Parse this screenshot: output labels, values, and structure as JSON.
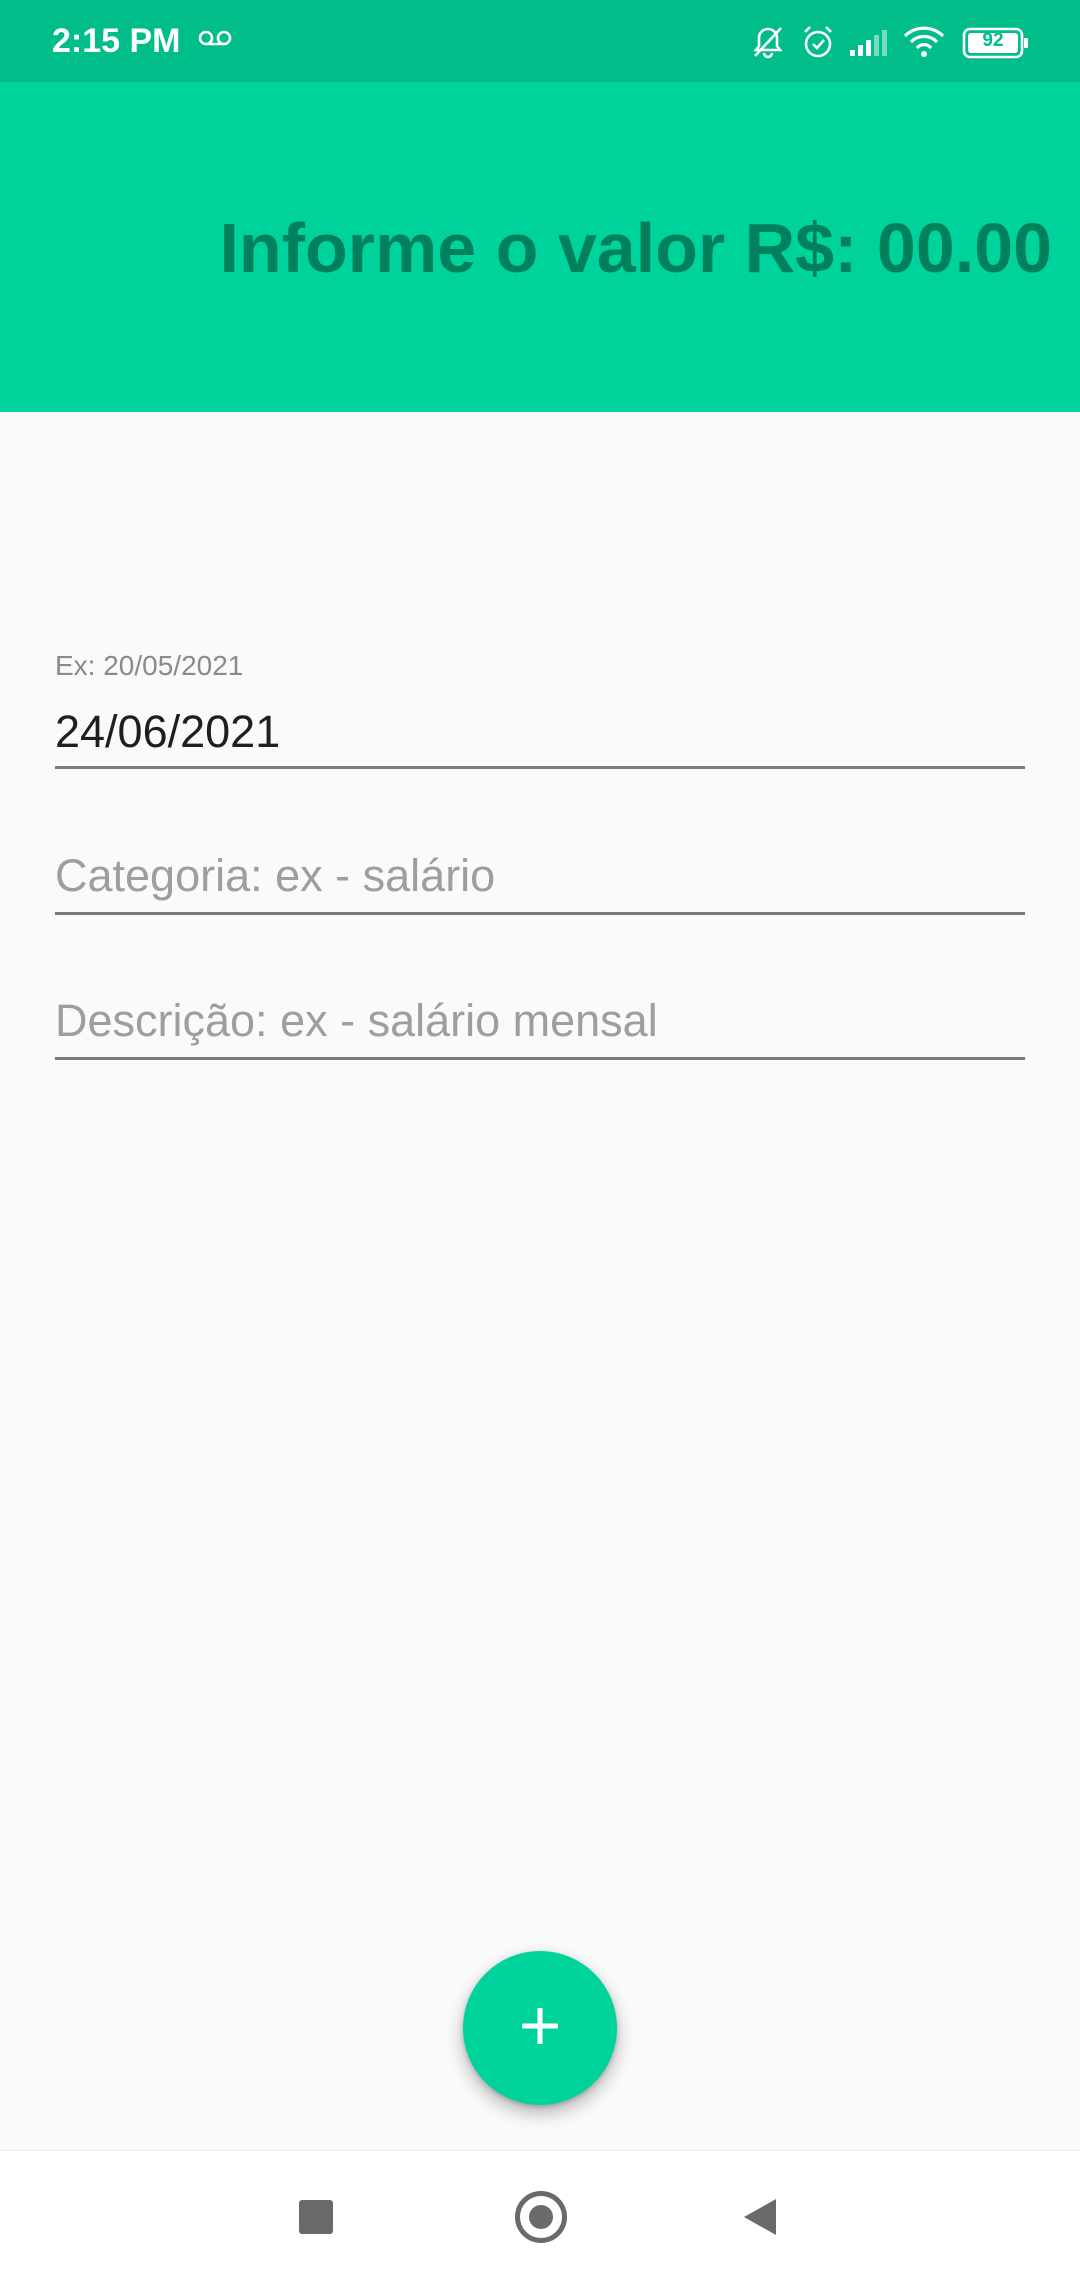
{
  "status_bar": {
    "time": "2:15 PM",
    "battery_level": "92",
    "icons": [
      "voicemail-icon",
      "bell-off-icon",
      "alarm-icon",
      "signal-icon",
      "wifi-icon",
      "battery-icon"
    ]
  },
  "header": {
    "title": "Informe o valor R$: 00.00",
    "background": "#00d29b",
    "text_color": "#00805c"
  },
  "form": {
    "date_label": "Ex: 20/05/2021",
    "date_value": "24/06/2021",
    "category_placeholder": "Categoria: ex - salário",
    "category_value": "",
    "description_placeholder": "Descrição: ex - salário mensal",
    "description_value": ""
  },
  "fab": {
    "icon": "plus-icon",
    "color": "#00d29b"
  },
  "nav_bar": {
    "icons": [
      "recents-icon",
      "home-icon",
      "back-icon"
    ]
  }
}
